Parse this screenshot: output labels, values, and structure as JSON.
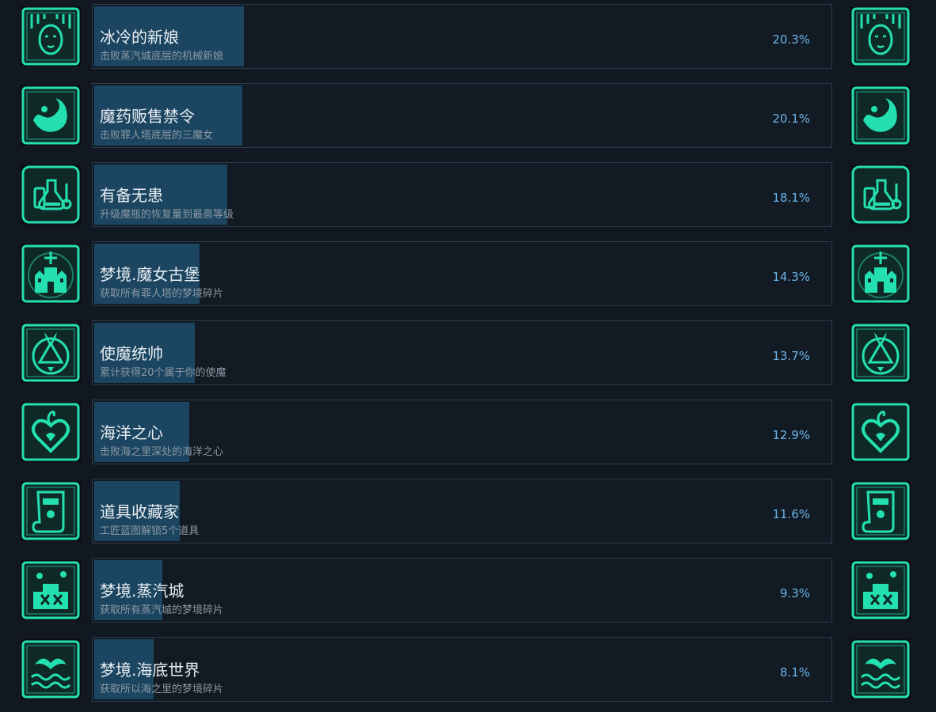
{
  "theme": {
    "icon_color": "#24e0b0",
    "fill_color": "#1b4560",
    "percent_color": "#6ab4e8",
    "background": "#111821"
  },
  "achievements": [
    {
      "title": "冰冷的新娘",
      "description": "击败蒸汽城底层的机械新娘",
      "percent_label": "20.3%",
      "percent": 20.3,
      "icon": "bride-mask-icon"
    },
    {
      "title": "魔药贩售禁令",
      "description": "击败罪人塔底层的三魔女",
      "percent_label": "20.1%",
      "percent": 20.1,
      "icon": "swirl-potion-icon"
    },
    {
      "title": "有备无患",
      "description": "升级魔瓶的恢复量到最高等级",
      "percent_label": "18.1%",
      "percent": 18.1,
      "icon": "flasks-icon"
    },
    {
      "title": "梦境.魔女古堡",
      "description": "获取所有罪人塔的梦境碎片",
      "percent_label": "14.3%",
      "percent": 14.3,
      "icon": "castle-icon"
    },
    {
      "title": "使魔统帅",
      "description": "累计获得20个属于你的使魔",
      "percent_label": "13.7%",
      "percent": 13.7,
      "icon": "summoning-circle-icon"
    },
    {
      "title": "海洋之心",
      "description": "击败海之里深处的海洋之心",
      "percent_label": "12.9%",
      "percent": 12.9,
      "icon": "heart-icon"
    },
    {
      "title": "道具收藏家",
      "description": "工匠蓝图解锁5个道具",
      "percent_label": "11.6%",
      "percent": 11.6,
      "icon": "scroll-icon"
    },
    {
      "title": "梦境.蒸汽城",
      "description": "获取所有蒸汽城的梦境碎片",
      "percent_label": "9.3%",
      "percent": 9.3,
      "icon": "steam-city-icon"
    },
    {
      "title": "梦境.海底世界",
      "description": "获取所以海之里的梦境碎片",
      "percent_label": "8.1%",
      "percent": 8.1,
      "icon": "sea-waves-icon"
    }
  ]
}
